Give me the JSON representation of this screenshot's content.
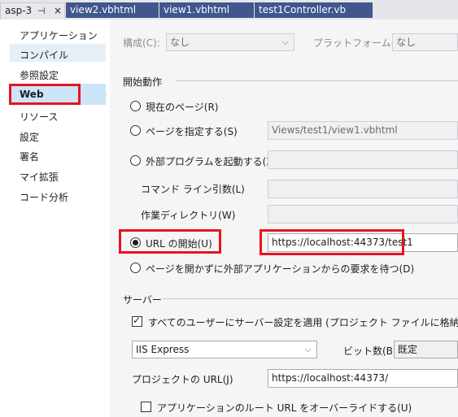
{
  "tabs": [
    {
      "label": "asp-3",
      "pin": "⊣",
      "close": "×"
    },
    {
      "label": "view2.vbhtml"
    },
    {
      "label": "view1.vbhtml"
    },
    {
      "label": "test1Controller.vb"
    }
  ],
  "sidebar": {
    "items": [
      {
        "label": "アプリケーション"
      },
      {
        "label": "コンパイル"
      },
      {
        "label": "参照設定"
      },
      {
        "label": "Web"
      },
      {
        "label": "リソース"
      },
      {
        "label": "設定"
      },
      {
        "label": "署名"
      },
      {
        "label": "マイ拡張"
      },
      {
        "label": "コード分析"
      }
    ]
  },
  "header": {
    "config_label": "構成(C):",
    "config_value": "なし",
    "platform_label": "プラットフォーム(M):",
    "platform_value": "なし"
  },
  "start_action": {
    "section": "開始動作",
    "current_page": "現在のページ(R)",
    "specific_page": "ページを指定する(S)",
    "specific_page_value": "Views/test1/view1.vbhtml",
    "start_external": "外部プログラムを起動する(X)",
    "command_args": "コマンド ライン引数(L)",
    "working_dir": "作業ディレクトリ(W)",
    "start_url": "URL の開始(U)",
    "start_url_value": "https://localhost:44373/test1",
    "dont_open": "ページを開かずに外部アプリケーションからの要求を待つ(D)"
  },
  "servers": {
    "section": "サーバー",
    "apply_all": "すべてのユーザーにサーバー設定を適用 (プロジェクト ファイルに格納)(A)",
    "server_value": "IIS Express",
    "bitness_label": "ビット数(B):",
    "bitness_value": "既定",
    "project_url_label": "プロジェクトの URL(J)",
    "project_url_value": "https://localhost:44373/",
    "override_root": "アプリケーションのルート URL をオーバーライドする(U)"
  },
  "colors": {
    "highlight": "#e8131e",
    "tab_active": "#40568d",
    "selection": "#cce4f7"
  }
}
